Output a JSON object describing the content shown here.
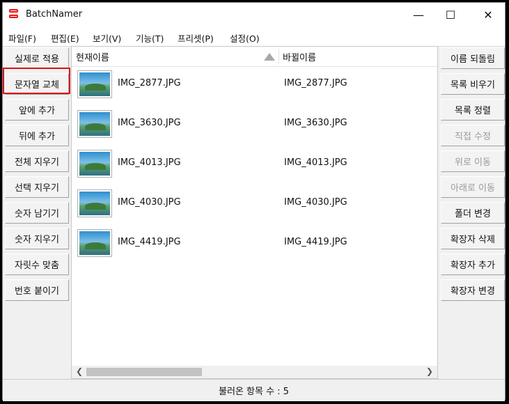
{
  "window": {
    "title": "BatchNamer",
    "min_symbol": "—",
    "max_symbol": "☐",
    "close_symbol": "✕"
  },
  "menu": [
    "파일(F)",
    "편집(E)",
    "보기(V)",
    "기능(T)",
    "프리셋(P)",
    "설정(O)"
  ],
  "left_buttons": [
    {
      "label": "실제로 적용"
    },
    {
      "label": "문자열 교체"
    },
    {
      "label": "앞에 추가"
    },
    {
      "label": "뒤에 추가"
    },
    {
      "label": "전체 지우기"
    },
    {
      "label": "선택 지우기"
    },
    {
      "label": "숫자 남기기"
    },
    {
      "label": "숫자 지우기"
    },
    {
      "label": "자릿수 맞춤"
    },
    {
      "label": "번호 붙이기"
    }
  ],
  "right_buttons": [
    {
      "label": "이름 되돌림",
      "enabled": true
    },
    {
      "label": "목록 비우기",
      "enabled": true
    },
    {
      "label": "목록 정렬",
      "enabled": true
    },
    {
      "label": "직접 수정",
      "enabled": false
    },
    {
      "label": "위로 이동",
      "enabled": false
    },
    {
      "label": "아래로 이동",
      "enabled": false
    },
    {
      "label": "폴더 변경",
      "enabled": true
    },
    {
      "label": "확장자 삭제",
      "enabled": true
    },
    {
      "label": "확장자 추가",
      "enabled": true
    },
    {
      "label": "확장자 변경",
      "enabled": true
    }
  ],
  "list": {
    "col_current": "현재이름",
    "col_new": "바뀔이름",
    "rows": [
      {
        "current": "IMG_2877.JPG",
        "new": "IMG_2877.JPG"
      },
      {
        "current": "IMG_3630.JPG",
        "new": "IMG_3630.JPG"
      },
      {
        "current": "IMG_4013.JPG",
        "new": "IMG_4013.JPG"
      },
      {
        "current": "IMG_4030.JPG",
        "new": "IMG_4030.JPG"
      },
      {
        "current": "IMG_4419.JPG",
        "new": "IMG_4419.JPG"
      }
    ]
  },
  "status": "불러온 항목 수 : 5",
  "colors": {
    "highlight": "#e01010",
    "accent_icon": "#e11111"
  }
}
